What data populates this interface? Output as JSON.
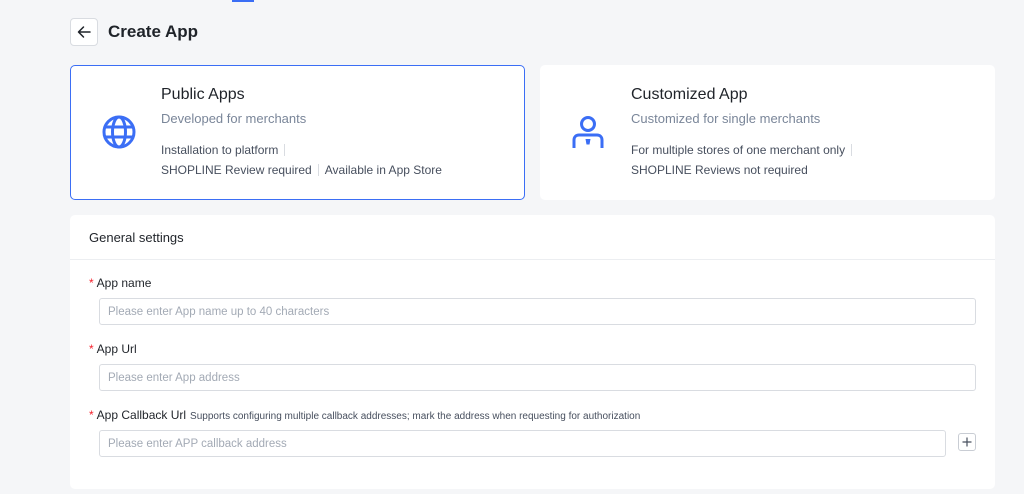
{
  "page": {
    "title": "Create App",
    "accent_color": "#3b6ef5"
  },
  "icons": {
    "back": "arrow-left-icon",
    "public": "globe-icon",
    "custom": "user-icon",
    "add": "plus-icon"
  },
  "cards": {
    "public": {
      "title": "Public Apps",
      "subtitle": "Developed for merchants",
      "features": [
        "Installation to platform",
        "SHOPLINE Review required",
        "Available in App Store"
      ],
      "selected": true
    },
    "custom": {
      "title": "Customized App",
      "subtitle": "Customized for single merchants",
      "features": [
        "For multiple stores of one merchant only",
        "SHOPLINE Reviews not required"
      ],
      "selected": false
    }
  },
  "general_settings": {
    "title": "General settings",
    "required_mark": "*",
    "app_name": {
      "label": "App name",
      "placeholder": "Please enter App name up to 40 characters",
      "value": ""
    },
    "app_url": {
      "label": "App Url",
      "placeholder": "Please enter App address",
      "value": ""
    },
    "callback_url": {
      "label": "App Callback Url",
      "hint": "Supports configuring multiple callback addresses; mark the address when requesting for authorization",
      "placeholder": "Please enter APP callback address",
      "value": ""
    }
  }
}
